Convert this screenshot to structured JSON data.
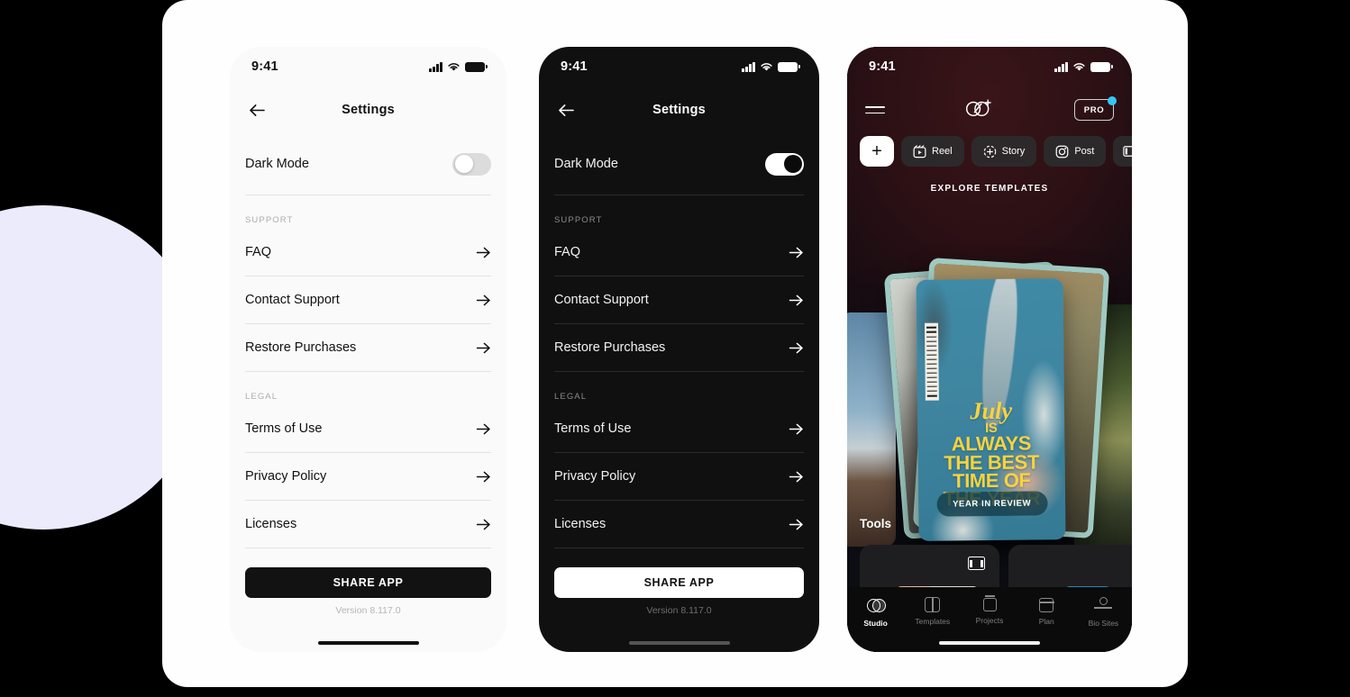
{
  "colors": {
    "background": "#000000",
    "canvas": "#fefeff",
    "blob_lavender": "#ecebfb",
    "light_phone_bg": "#fafafa",
    "dark_phone_bg": "#101010",
    "accent_cyan": "#35c6f4",
    "card_yellow": "#f5d341"
  },
  "status_bar": {
    "time": "9:41",
    "signal": "cellular-bars",
    "wifi": "wifi-icon",
    "battery": "battery-icon"
  },
  "settings_light": {
    "title": "Settings",
    "back": "back-arrow",
    "dark_mode": {
      "label": "Dark Mode",
      "state": "off"
    },
    "sections": [
      {
        "heading": "SUPPORT",
        "items": [
          "FAQ",
          "Contact Support",
          "Restore Purchases"
        ]
      },
      {
        "heading": "LEGAL",
        "items": [
          "Terms of Use",
          "Privacy Policy",
          "Licenses"
        ]
      }
    ],
    "share_button": "SHARE APP",
    "version": "Version 8.117.0"
  },
  "settings_dark": {
    "title": "Settings",
    "back": "back-arrow",
    "dark_mode": {
      "label": "Dark Mode",
      "state": "on"
    },
    "sections": [
      {
        "heading": "SUPPORT",
        "items": [
          "FAQ",
          "Contact Support",
          "Restore Purchases"
        ]
      },
      {
        "heading": "LEGAL",
        "items": [
          "Terms of Use",
          "Privacy Policy",
          "Licenses"
        ]
      }
    ],
    "share_button": "SHARE APP",
    "version": "Version 8.117.0"
  },
  "app_home": {
    "menu": "hamburger-menu",
    "logo": "overlapping-circles-plus-logo",
    "pro_badge": "PRO",
    "chips": [
      {
        "label": "",
        "icon": "plus-icon"
      },
      {
        "label": "Reel",
        "icon": "reel-icon"
      },
      {
        "label": "Story",
        "icon": "story-icon"
      },
      {
        "label": "Post",
        "icon": "post-icon"
      },
      {
        "label": "",
        "icon": "film-icon"
      }
    ],
    "explore_label": "EXPLORE TEMPLATES",
    "template_card": {
      "lines": [
        "July",
        "IS",
        "ALWAYS",
        "THE BEST",
        "TIME OF",
        "THE YEAR"
      ],
      "pill": "YEAR IN REVIEW"
    },
    "tools_label": "Tools",
    "tabs": [
      {
        "label": "Studio",
        "icon": "studio-icon",
        "active": true
      },
      {
        "label": "Templates",
        "icon": "templates-icon",
        "active": false
      },
      {
        "label": "Projects",
        "icon": "projects-icon",
        "active": false
      },
      {
        "label": "Plan",
        "icon": "plan-icon",
        "active": false
      },
      {
        "label": "Bio Sites",
        "icon": "bio-sites-icon",
        "active": false
      }
    ]
  }
}
